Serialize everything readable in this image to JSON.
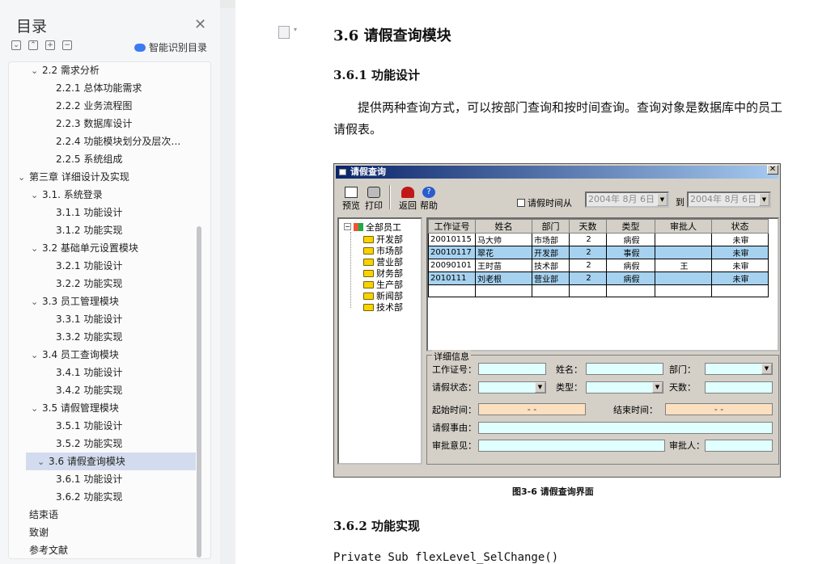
{
  "toc": {
    "title": "目录",
    "smart_label": "智能识别目录",
    "items": [
      {
        "label": "2.2  需求分析",
        "level": 1,
        "expanded": true
      },
      {
        "label": "2.2.1  总体功能需求",
        "level": 2
      },
      {
        "label": "2.2.2  业务流程图",
        "level": 2
      },
      {
        "label": "2.2.3  数据库设计",
        "level": 2
      },
      {
        "label": "2.2.4     功能模块划分及层次…",
        "level": 2
      },
      {
        "label": "2.2.5     系统组成",
        "level": 2
      },
      {
        "label": "第三章  详细设计及实现",
        "level": 0,
        "expanded": true
      },
      {
        "label": "3.1.  系统登录",
        "level": 1,
        "expanded": true
      },
      {
        "label": "3.1.1  功能设计",
        "level": 2
      },
      {
        "label": "3.1.2  功能实现",
        "level": 2
      },
      {
        "label": "3.2    基础单元设置模块",
        "level": 1,
        "expanded": true
      },
      {
        "label": "3.2.1  功能设计",
        "level": 2
      },
      {
        "label": "3.2.2  功能实现",
        "level": 2
      },
      {
        "label": "3.3  员工管理模块",
        "level": 1,
        "expanded": true
      },
      {
        "label": "3.3.1  功能设计",
        "level": 2
      },
      {
        "label": "3.3.2  功能实现",
        "level": 2
      },
      {
        "label": "3.4      员工查询模块",
        "level": 1,
        "expanded": true
      },
      {
        "label": "3.4.1  功能设计",
        "level": 2
      },
      {
        "label": "3.4.2  功能实现",
        "level": 2
      },
      {
        "label": "3.5  请假管理模块",
        "level": 1,
        "expanded": true
      },
      {
        "label": "3.5.1  功能设计",
        "level": 2
      },
      {
        "label": "3.5.2  功能实现",
        "level": 2
      },
      {
        "label": "3.6  请假查询模块",
        "level": 1,
        "expanded": true,
        "active": true
      },
      {
        "label": "3.6.1  功能设计",
        "level": 2
      },
      {
        "label": "3.6.2  功能实现",
        "level": 2
      },
      {
        "label": "结束语",
        "level": 0
      },
      {
        "label": "致谢",
        "level": 0
      },
      {
        "label": "参考文献",
        "level": 0
      }
    ]
  },
  "doc": {
    "heading": "3.6  请假查询模块",
    "sub1": "3.6.1  功能设计",
    "paragraph": "提供两种查询方式，可以按部门查询和按时间查询。查询对象是数据库中的员工请假表。",
    "caption": "图3-6 请假查询界面",
    "sub2": "3.6.2  功能实现",
    "code": "Private Sub flexLevel_SelChange()"
  },
  "window": {
    "title": "请假查询",
    "tools": [
      "预览",
      "打印",
      "返回",
      "帮助"
    ],
    "checkbox_label": "请假时间从",
    "date_from": "2004年 8月 6日",
    "to_label": "到",
    "date_to": "2004年 8月 6日",
    "tree": {
      "root": "全部员工",
      "children": [
        "开发部",
        "市场部",
        "营业部",
        "财务部",
        "生产部",
        "新闻部",
        "技术部"
      ]
    },
    "columns": [
      "工作证号",
      "姓名",
      "部门",
      "天数",
      "类型",
      "审批人",
      "状态"
    ],
    "rows": [
      {
        "cells": [
          "20010115",
          "马大帅",
          "市场部",
          "2",
          "病假",
          "",
          "未审"
        ],
        "selected": false
      },
      {
        "cells": [
          "20010117",
          "翠花",
          "开发部",
          "2",
          "事假",
          "",
          "未审"
        ],
        "selected": true
      },
      {
        "cells": [
          "20090101",
          "王时苗",
          "技术部",
          "2",
          "病假",
          "王",
          "未审"
        ],
        "selected": false
      },
      {
        "cells": [
          "2010111",
          "刘老根",
          "营业部",
          "2",
          "病假",
          "",
          "未审"
        ],
        "selected": true
      },
      {
        "cells": [
          "",
          "",
          "",
          "",
          "",
          "",
          ""
        ],
        "selected": false
      }
    ],
    "detail": {
      "legend": "详细信息",
      "labels": {
        "id": "工作证号：",
        "name": "姓名：",
        "dept": "部门：",
        "status": "请假状态：",
        "type": "类型：",
        "days": "天数：",
        "start": "起始时间：",
        "end": "结束时间：",
        "reason": "请假事由：",
        "opinion": "审批意见：",
        "approver": "审批人："
      },
      "start_value": "-    -",
      "end_value": "-    -"
    }
  }
}
